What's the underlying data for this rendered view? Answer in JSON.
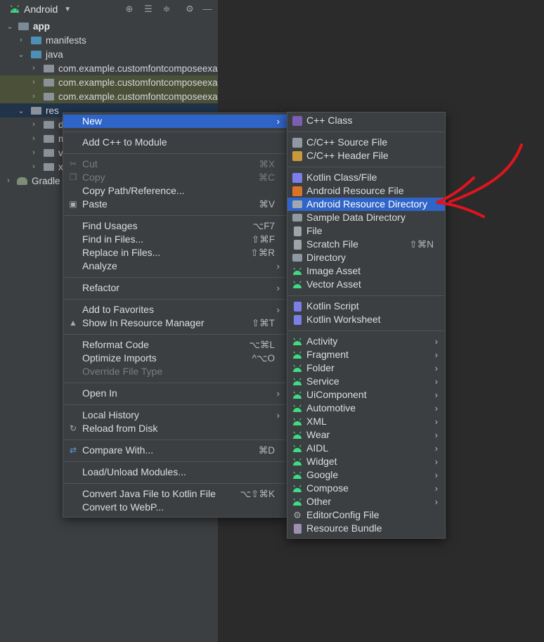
{
  "toolbar": {
    "title": "Android",
    "icons": [
      "target-icon",
      "expand-all-icon",
      "collapse-all-icon",
      "gear-icon",
      "minimize-icon"
    ]
  },
  "tree": [
    {
      "label": "app",
      "bold": true
    },
    {
      "label": "manifests"
    },
    {
      "label": "java"
    },
    {
      "label": "com.example.customfontcomposeexa"
    },
    {
      "label": "com.example.customfontcomposeexa"
    },
    {
      "label": "com.example.customfontcomposeexa"
    },
    {
      "label": "res"
    },
    {
      "label": "d"
    },
    {
      "label": "m"
    },
    {
      "label": "va"
    },
    {
      "label": "xr"
    },
    {
      "label": "Gradle"
    }
  ],
  "context_menu": {
    "new": "New",
    "add_cpp": "Add C++ to Module",
    "cut": "Cut",
    "cut_sc": "⌘X",
    "copy": "Copy",
    "copy_sc": "⌘C",
    "copy_path": "Copy Path/Reference...",
    "paste": "Paste",
    "paste_sc": "⌘V",
    "find_usages": "Find Usages",
    "find_usages_sc": "⌥F7",
    "find_in_files": "Find in Files...",
    "find_in_files_sc": "⇧⌘F",
    "replace_in_files": "Replace in Files...",
    "replace_in_files_sc": "⇧⌘R",
    "analyze": "Analyze",
    "refactor": "Refactor",
    "add_fav": "Add to Favorites",
    "show_res": "Show In Resource Manager",
    "show_res_sc": "⇧⌘T",
    "reformat": "Reformat Code",
    "reformat_sc": "⌥⌘L",
    "optimize": "Optimize Imports",
    "optimize_sc": "^⌥O",
    "override": "Override File Type",
    "open_in": "Open In",
    "local_history": "Local History",
    "reload": "Reload from Disk",
    "compare": "Compare With...",
    "compare_sc": "⌘D",
    "load_unload": "Load/Unload Modules...",
    "convert_kotlin": "Convert Java File to Kotlin File",
    "convert_kotlin_sc": "⌥⇧⌘K",
    "convert_webp": "Convert to WebP..."
  },
  "new_submenu": {
    "items": [
      "C++ Class",
      "C/C++ Source File",
      "C/C++ Header File",
      "Kotlin Class/File",
      "Android Resource File",
      "Android Resource Directory",
      "Sample Data Directory",
      "File",
      "Scratch File",
      "Directory",
      "Image Asset",
      "Vector Asset",
      "Kotlin Script",
      "Kotlin Worksheet",
      "Activity",
      "Fragment",
      "Folder",
      "Service",
      "UiComponent",
      "Automotive",
      "XML",
      "Wear",
      "AIDL",
      "Widget",
      "Google",
      "Compose",
      "Other",
      "EditorConfig File",
      "Resource Bundle"
    ],
    "scratch_sc": "⇧⌘N"
  },
  "colors": {
    "selection": "#2f64c8",
    "android_green": "#3ddc84",
    "annotation_red": "#e0141e"
  }
}
